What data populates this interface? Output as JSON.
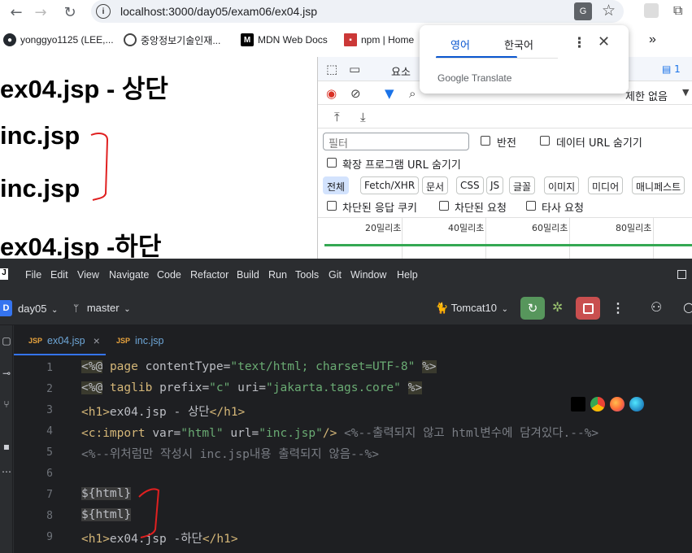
{
  "browser": {
    "url": "localhost:3000/day05/exam06/ex04.jsp",
    "info_icon": "i",
    "bookmarks": [
      {
        "label": "yonggyo1125 (LEE,..."
      },
      {
        "label": "중앙정보기술인재..."
      },
      {
        "label": "MDN Web Docs"
      },
      {
        "label": "npm | Home"
      }
    ],
    "bookmarks_more": "»"
  },
  "page": {
    "header": "ex04.jsp - 상단",
    "include1": "inc.jsp",
    "include2": "inc.jsp",
    "footer": "ex04.jsp -하단"
  },
  "translate_popup": {
    "tab_source": "영어",
    "tab_target": "한국어",
    "brand": "Google Translate"
  },
  "devtools": {
    "panel_tab": "요소",
    "issues_count": "1",
    "throttle": "제한 없음",
    "filter_placeholder": "필터",
    "invert_label": "반전",
    "hide_data_url_label": "데이터 URL 숨기기",
    "hide_ext_url_label": "확장 프로그램 URL 숨기기",
    "type_chips": [
      "전체",
      "Fetch/XHR",
      "문서",
      "CSS",
      "JS",
      "글꼴",
      "이미지",
      "미디어",
      "매니페스트"
    ],
    "blocked_cookies_label": "차단된 응답 쿠키",
    "blocked_requests_label": "차단된 요청",
    "third_party_label": "타사 요청",
    "timeline_ticks": [
      "20밀리초",
      "40밀리초",
      "60밀리초",
      "80밀리초"
    ]
  },
  "ide": {
    "menu": [
      "File",
      "Edit",
      "View",
      "Navigate",
      "Code",
      "Refactor",
      "Build",
      "Run",
      "Tools",
      "Git",
      "Window",
      "Help"
    ],
    "project_badge": "D",
    "project_name": "day05",
    "branch": "master",
    "run_config": "Tomcat10",
    "tabs": [
      {
        "label": "ex04.jsp",
        "badge": "JSP",
        "active": true
      },
      {
        "label": "inc.jsp",
        "badge": "JSP",
        "active": false
      }
    ],
    "close_symbol": "×",
    "line_numbers": [
      "1",
      "2",
      "3",
      "4",
      "5",
      "6",
      "7",
      "8",
      "9"
    ]
  }
}
